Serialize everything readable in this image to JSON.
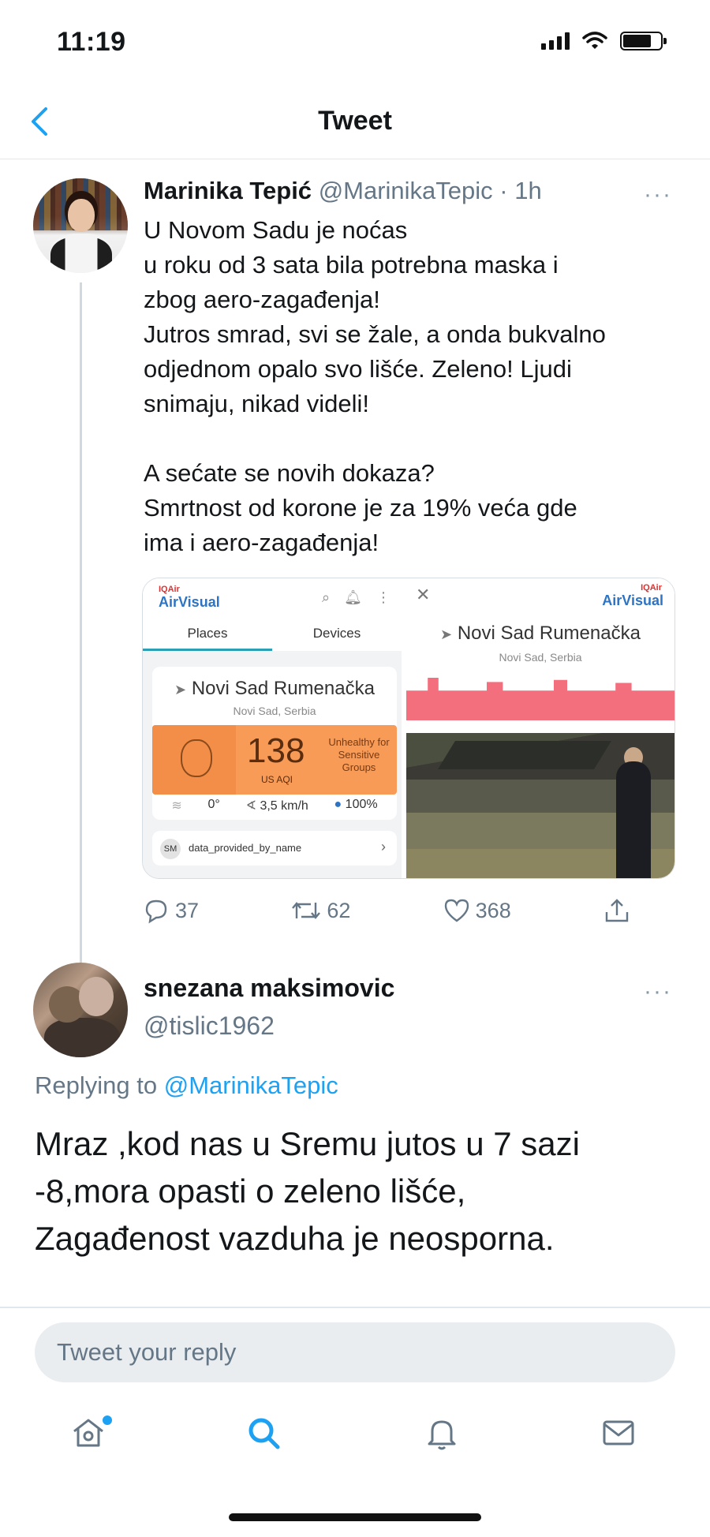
{
  "status_bar": {
    "time": "11:19"
  },
  "header": {
    "title": "Tweet"
  },
  "tweet": {
    "author_name": "Marinika Tepić",
    "author_handle": "@MarinikaTepic",
    "separator": " · ",
    "time": "1h",
    "more": "···",
    "text": "U Novom Sadu je noćas\nu roku od 3 sata bila potrebna maska i\nzbog aero-zagađenja!\nJutros smrad, svi se žale, a onda bukvalno\nodjednom opalo svo lišće. Zeleno! Ljudi\nsnimaju, nikad videli!\n\nA sećate se novih dokaza?\nSmrtnost od korone je za 19% veća gde\nima i aero-zagađenja!",
    "media": {
      "left": {
        "logo_small": "IQAir",
        "logo": "AirVisual",
        "tabs": [
          "Places",
          "Devices"
        ],
        "location": "Novi Sad Rumenačka",
        "sublocation": "Novi Sad, Serbia",
        "aqi_value": "138",
        "aqi_unit": "US AQI",
        "aqi_label": "Unhealthy for Sensitive Groups",
        "temperature": "0°",
        "wind": "3,5 km/h",
        "humidity": "100%",
        "provider_badge": "SM",
        "provider": "data_provided_by_name"
      },
      "right": {
        "logo_small": "IQAir",
        "logo": "AirVisual",
        "location": "Novi Sad Rumenačka",
        "sublocation": "Novi Sad, Serbia"
      }
    },
    "actions": {
      "replies": "37",
      "retweets": "62",
      "likes": "368"
    }
  },
  "reply": {
    "author_name": "snezana maksimovic",
    "author_handle": "@tislic1962",
    "more": "···",
    "replying_prefix": "Replying to ",
    "replying_to": "@MarinikaTepic",
    "text": "Mraz ,kod nas u Sremu jutos u 7 sazi\n-8,mora opasti o zeleno lišće,\nZagađenost vazduha je neosporna."
  },
  "reply_box": {
    "placeholder": "Tweet your reply"
  },
  "tab_bar": {
    "items": [
      {
        "icon": "home-icon",
        "active": false,
        "has_dot": true
      },
      {
        "icon": "search-icon",
        "active": true
      },
      {
        "icon": "bell-icon",
        "active": false
      },
      {
        "icon": "mail-icon",
        "active": false
      }
    ]
  },
  "colors": {
    "accent": "#1da1f2",
    "secondary_text": "#657786",
    "aqi_orange": "#f89b57"
  }
}
